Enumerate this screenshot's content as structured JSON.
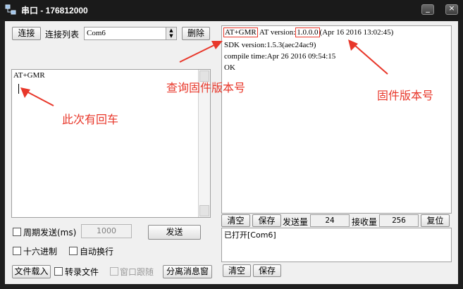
{
  "window": {
    "title": "串口 - 176812000",
    "min_glyph": "_",
    "close_glyph": "×"
  },
  "toolbar": {
    "connect_label": "连接",
    "conn_list_label": "连接列表",
    "port_value": "Com6",
    "delete_label": "删除"
  },
  "send_area": {
    "text": "AT+GMR"
  },
  "recv_area": {
    "line1_cmd": "AT+GMR",
    "line1_mid": " AT version:",
    "line1_version": "1.0.0.0",
    "line1_rest": "(Apr 16 2016 13:02:45)",
    "line2": "SDK version:1.5.3(aec24ac9)",
    "line3": "compile time:Apr 26 2016 09:54:15",
    "line4": "OK"
  },
  "stats": {
    "clear_label": "清空",
    "save_label": "保存",
    "sent_label": "发送量",
    "sent_value": "24",
    "recv_label": "接收量",
    "recv_value": "256",
    "reset_label": "复位"
  },
  "log": {
    "text": "已打开[Com6]",
    "clear_label": "清空",
    "save_label": "保存"
  },
  "options": {
    "periodic_label": "周期发送(ms)",
    "period_value": "1000",
    "send_label": "发送",
    "hex_label": "十六进制",
    "autowrap_label": "自动换行",
    "load_file_label": "文件载入",
    "record_file_label": "转录文件",
    "follow_window_label": "窗口跟随",
    "detach_label": "分离消息窗"
  },
  "annotations": {
    "query_version": "查询固件版本号",
    "firmware_version": "固件版本号",
    "has_enter": "此次有回车",
    "color": "#e8372a"
  }
}
